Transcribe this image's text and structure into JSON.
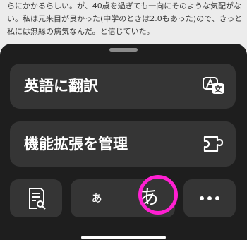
{
  "article": {
    "lines": [
      "らにかかるらしい。が、40歳を過ぎても一向にそのような気配がな",
      "い。私は元来目が良かった(中学のときは2.0もあった)ので、きっと",
      "私には無縁の病気なんだ。と信じていた。"
    ]
  },
  "menu": {
    "translate_label": "英語に翻訳",
    "translate_icon": "translate-icon",
    "extensions_label": "機能拡張を管理",
    "extensions_icon": "puzzle-icon",
    "reader_icon": "reader-view-icon",
    "font_smaller_label": "ぁ",
    "font_larger_label": "あ",
    "more_icon": "ellipsis-icon",
    "highlight_color": "#ff1fd2"
  }
}
